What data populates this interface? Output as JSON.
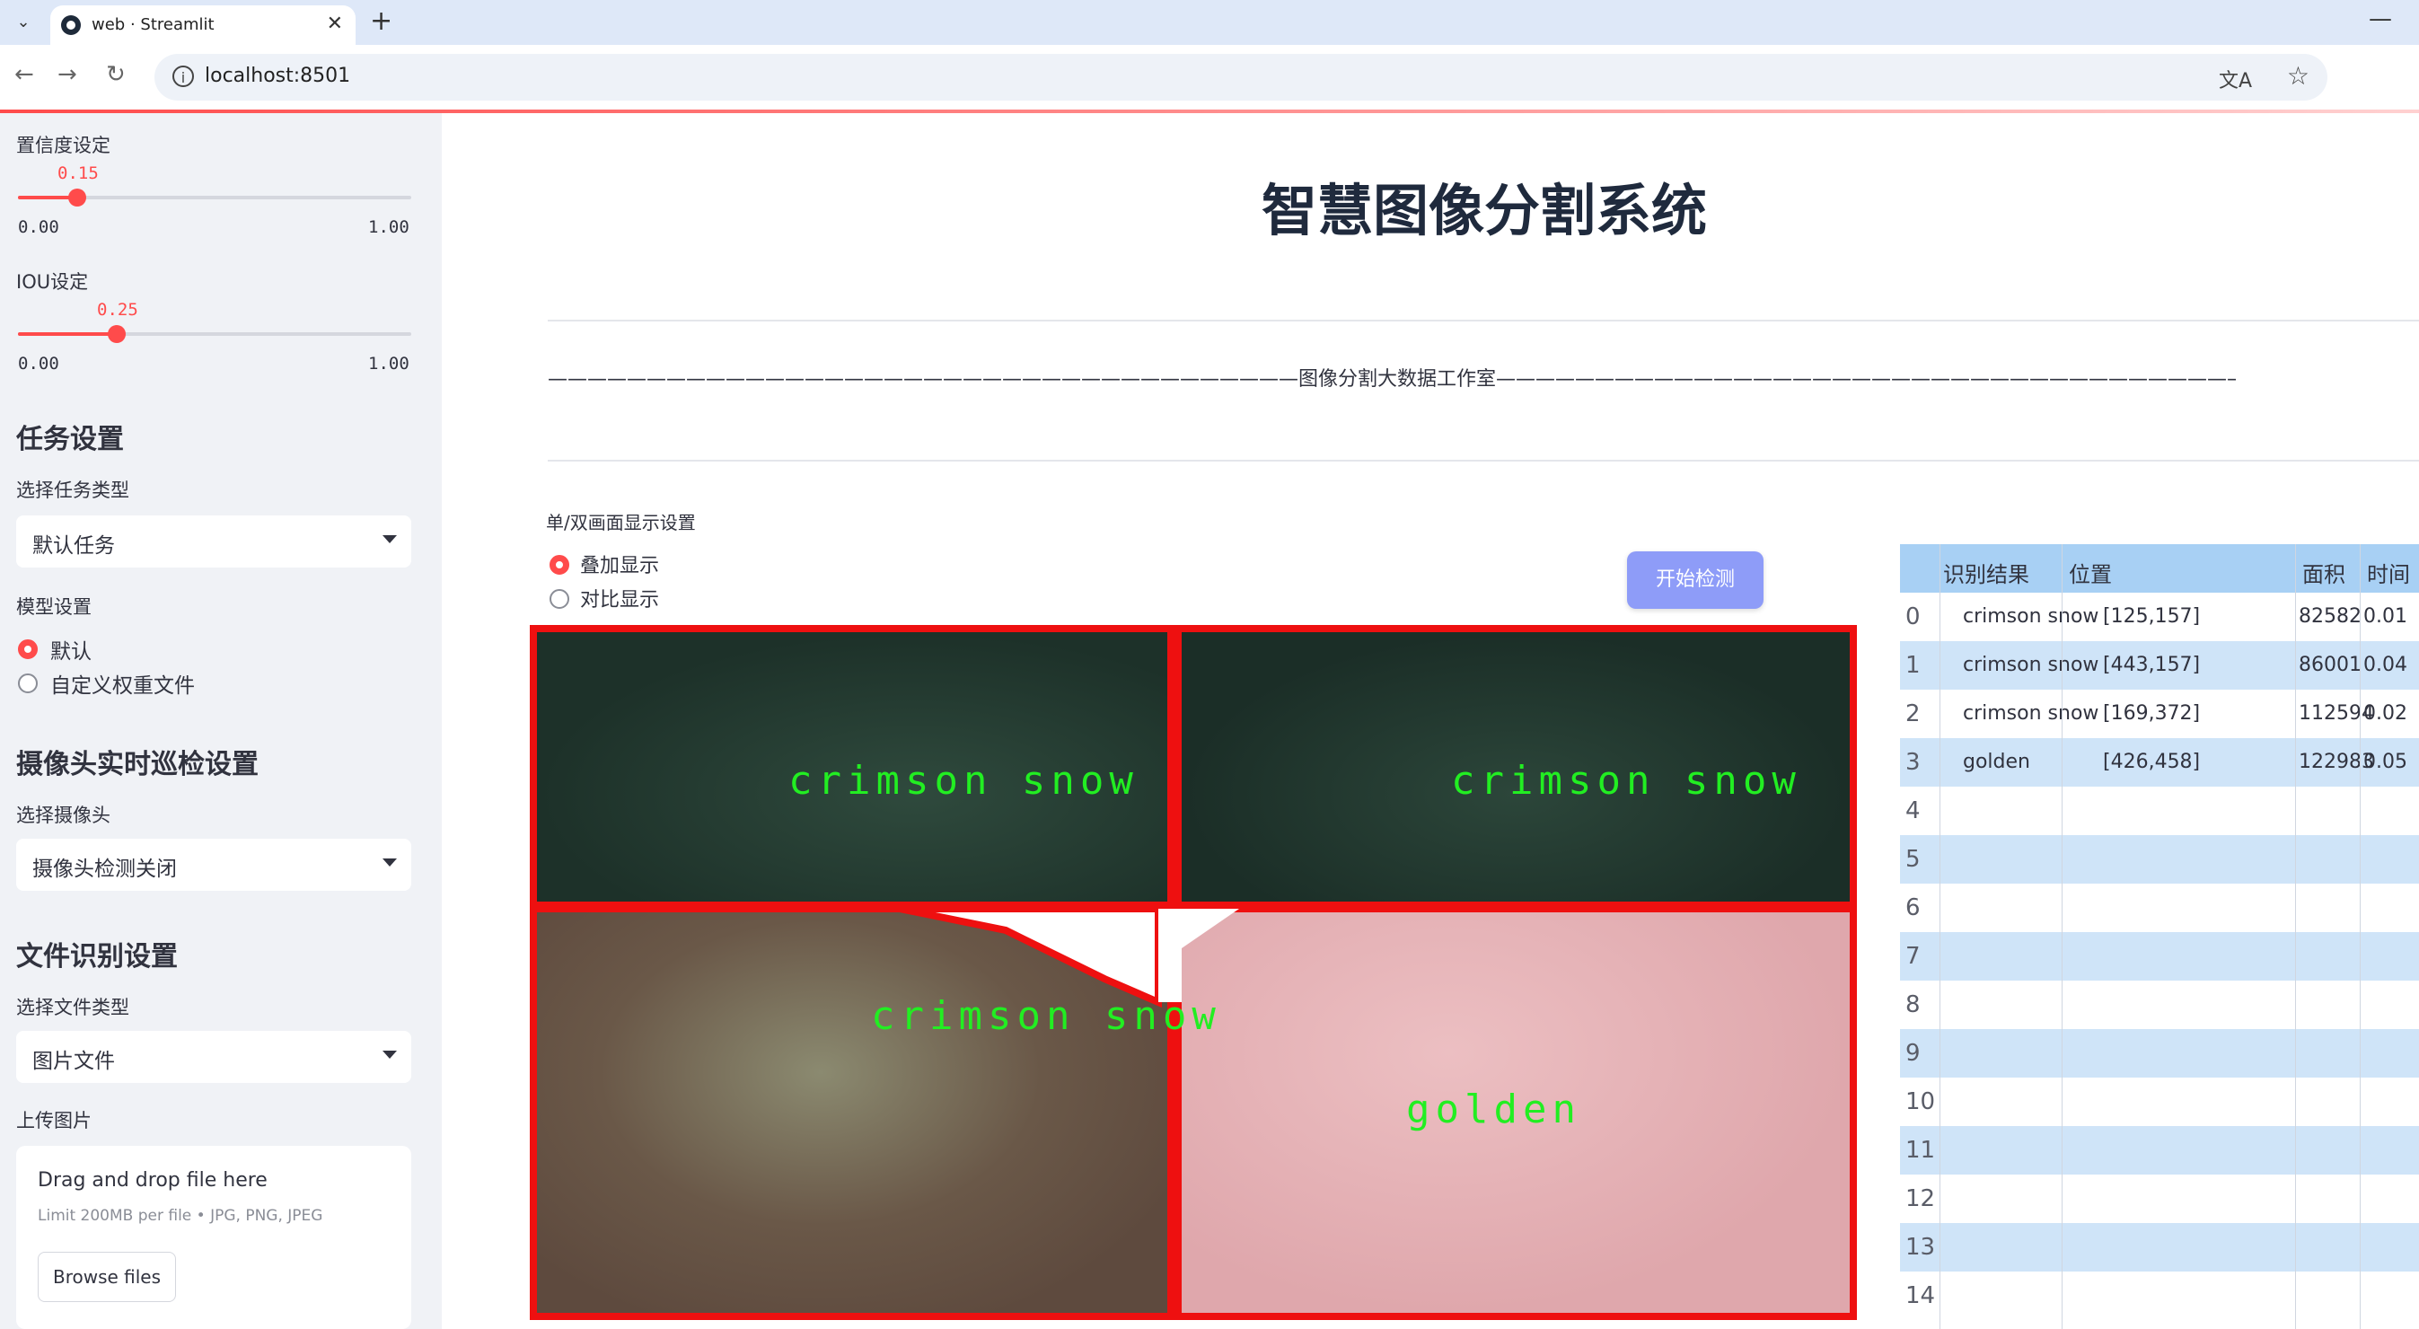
{
  "browser": {
    "tab_title": "web · Streamlit",
    "url": "localhost:8501"
  },
  "sidebar": {
    "confidence_label": "置信度设定",
    "confidence_value": "0.15",
    "confidence_fraction": 0.15,
    "confidence_min": "0.00",
    "confidence_max": "1.00",
    "iou_label": "IOU设定",
    "iou_value": "0.25",
    "iou_fraction": 0.25,
    "iou_min": "0.00",
    "iou_max": "1.00",
    "task_heading": "任务设置",
    "task_type_label": "选择任务类型",
    "task_type_value": "默认任务",
    "model_label": "模型设置",
    "model_options": [
      "默认",
      "自定义权重文件"
    ],
    "model_selected": "默认",
    "camera_heading": "摄像头实时巡检设置",
    "camera_label": "选择摄像头",
    "camera_value": "摄像头检测关闭",
    "file_heading": "文件识别设置",
    "file_type_label": "选择文件类型",
    "file_type_value": "图片文件",
    "upload_label": "上传图片",
    "dropzone_title": "Drag and drop file here",
    "dropzone_sub": "Limit 200MB per file • JPG, PNG, JPEG",
    "browse_button": "Browse files"
  },
  "main": {
    "title": "智慧图像分割系统",
    "subtitle_line": "——————————————————————————————————————图像分割大数据工作室——————————————————————————————————————",
    "display_label": "单/双画面显示设置",
    "display_options": [
      "叠加显示",
      "对比显示"
    ],
    "display_selected": "叠加显示",
    "start_button": "开始检测",
    "detections": [
      "crimson snow",
      "crimson snow",
      "crimson snow",
      "golden"
    ]
  },
  "table": {
    "headers": [
      "识别结果",
      "位置",
      "面积",
      "时间"
    ],
    "rows": [
      {
        "idx": "0",
        "result": "crimson snow",
        "pos": "[125,157]",
        "area": "82582",
        "time": "0.01"
      },
      {
        "idx": "1",
        "result": "crimson snow",
        "pos": "[443,157]",
        "area": "86001",
        "time": "0.04"
      },
      {
        "idx": "2",
        "result": "crimson snow",
        "pos": "[169,372]",
        "area": "112594",
        "time": "0.02"
      },
      {
        "idx": "3",
        "result": "golden",
        "pos": "[426,458]",
        "area": "122983",
        "time": "0.05"
      },
      {
        "idx": "4"
      },
      {
        "idx": "5"
      },
      {
        "idx": "6"
      },
      {
        "idx": "7"
      },
      {
        "idx": "8"
      },
      {
        "idx": "9"
      },
      {
        "idx": "10"
      },
      {
        "idx": "11"
      },
      {
        "idx": "12"
      },
      {
        "idx": "13"
      },
      {
        "idx": "14"
      }
    ]
  },
  "colors": {
    "accent": "#ff4b4b",
    "button": "#8e9cf8",
    "detection_text": "#22ee22",
    "mask_border": "#ee1010",
    "table_header": "#a8d0f4",
    "table_alt_row": "#cfe4f8"
  }
}
